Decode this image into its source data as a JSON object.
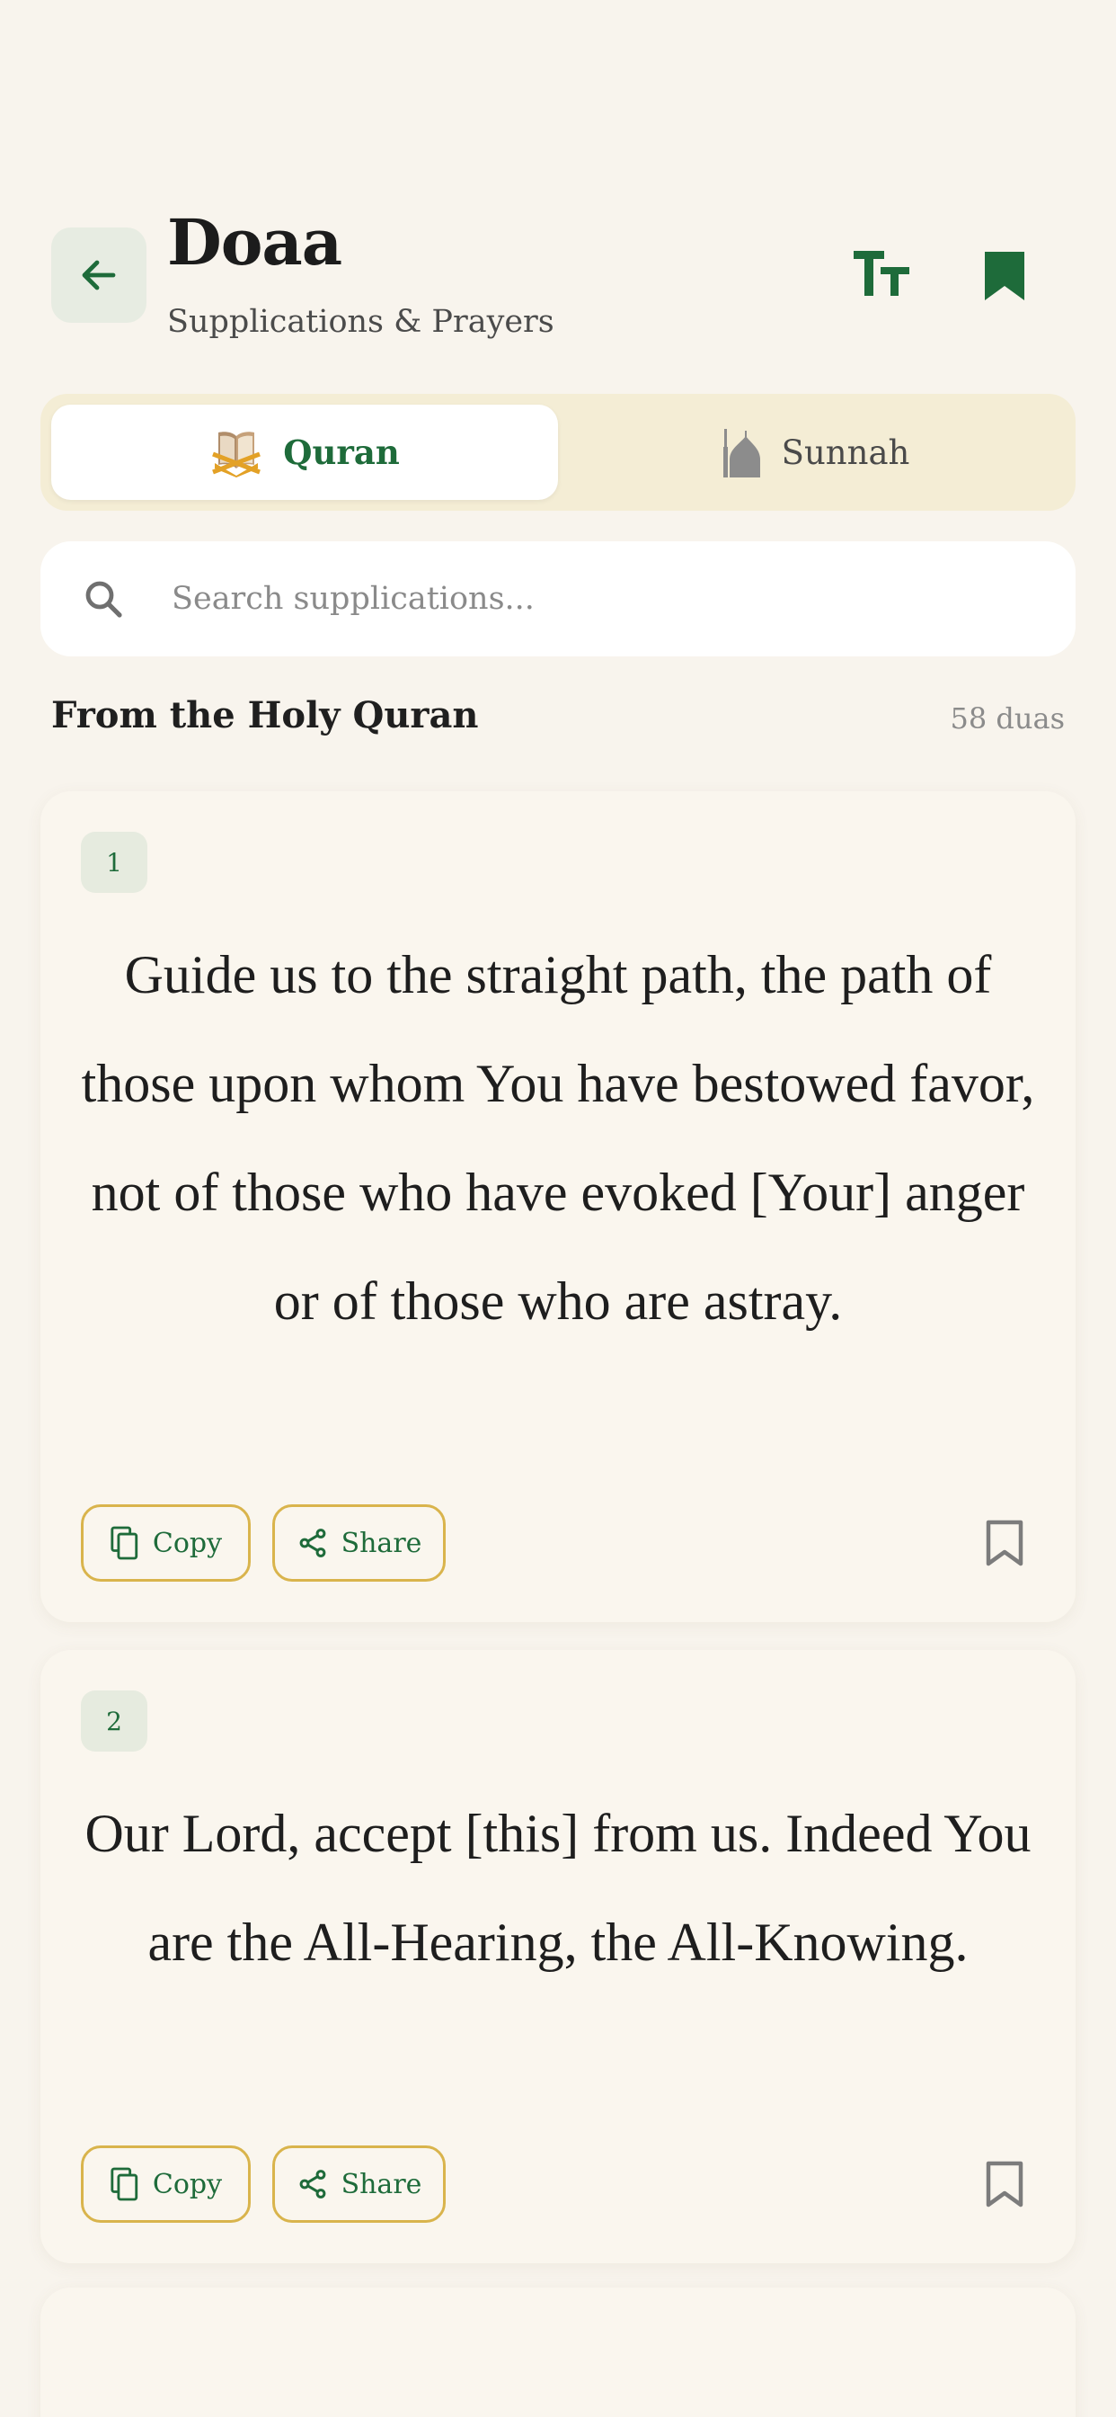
{
  "header": {
    "title": "Doaa",
    "subtitle": "Supplications & Prayers",
    "back_icon": "arrow-left-icon",
    "text_size_icon": "text-size-icon",
    "bookmarks_icon": "bookmark-filled-icon"
  },
  "tabs": [
    {
      "label": "Quran",
      "icon": "open-book-icon",
      "active": true
    },
    {
      "label": "Sunnah",
      "icon": "mosque-icon",
      "active": false
    }
  ],
  "search": {
    "placeholder": "Search supplications...",
    "value": ""
  },
  "section": {
    "title": "From the Holy Quran",
    "count": "58 duas"
  },
  "cards": [
    {
      "number": "1",
      "text": "Guide us to the straight path, the path of those upon whom You have bestowed favor, not of those who have evoked [Your] anger or of those who are astray.",
      "copy_label": "Copy",
      "share_label": "Share"
    },
    {
      "number": "2",
      "text": "Our Lord, accept [this] from us. Indeed You are the All-Hearing, the All-Knowing.",
      "copy_label": "Copy",
      "share_label": "Share"
    }
  ],
  "colors": {
    "background": "#f8f4ed",
    "primary_green": "#1e6b3a",
    "gold_border": "#d9b44c",
    "tab_track": "#f4edd5"
  }
}
